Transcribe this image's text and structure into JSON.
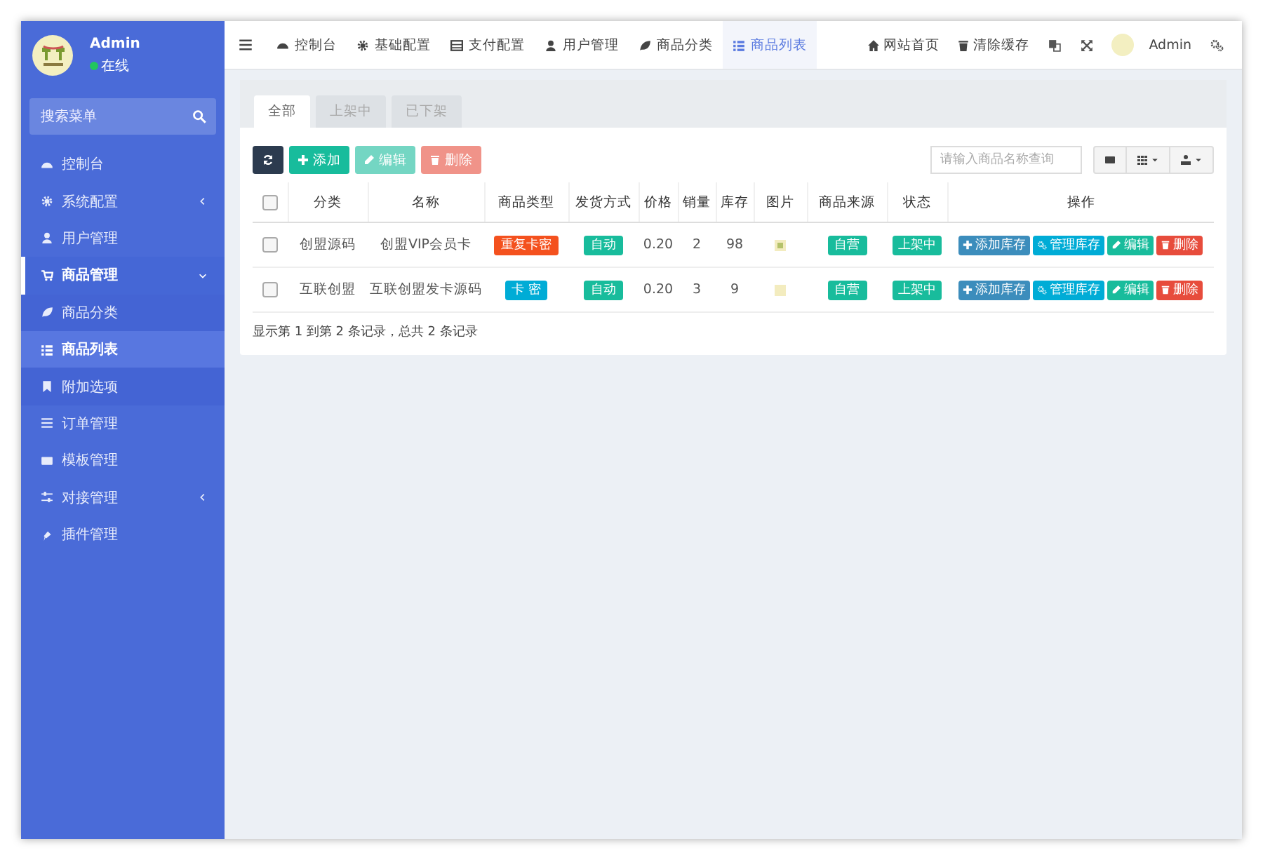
{
  "sidebar": {
    "user": {
      "name": "Admin",
      "status": "在线",
      "online": true
    },
    "search": {
      "placeholder": "搜索菜单"
    },
    "items": [
      {
        "label": "控制台",
        "selected": false
      },
      {
        "label": "系统配置",
        "selected": false,
        "expanded": false
      },
      {
        "label": "用户管理",
        "selected": false
      },
      {
        "label": "商品管理",
        "selected": false,
        "expanded": true,
        "children": [
          {
            "label": "商品分类",
            "selected": false
          },
          {
            "label": "商品列表",
            "selected": true
          },
          {
            "label": "附加选项",
            "selected": false
          }
        ]
      },
      {
        "label": "订单管理",
        "selected": false
      },
      {
        "label": "模板管理",
        "selected": false
      },
      {
        "label": "对接管理",
        "selected": false,
        "expanded": false
      },
      {
        "label": "插件管理",
        "selected": false
      }
    ]
  },
  "top_nav": {
    "tabs": [
      {
        "label": "控制台",
        "selected": false
      },
      {
        "label": "基础配置",
        "selected": false
      },
      {
        "label": "支付配置",
        "selected": false
      },
      {
        "label": "用户管理",
        "selected": false
      },
      {
        "label": "商品分类",
        "selected": false
      },
      {
        "label": "商品列表",
        "selected": true
      }
    ],
    "links": [
      "网站首页",
      "清除缓存"
    ],
    "user": "Admin"
  },
  "filter_tabs": [
    {
      "label": "全部",
      "selected": true
    },
    {
      "label": "上架中",
      "selected": false
    },
    {
      "label": "已下架",
      "selected": false
    }
  ],
  "toolbar": {
    "buttons": [
      {
        "kind": "refresh",
        "disabled": false
      },
      {
        "kind": "add",
        "label": "添加",
        "disabled": false
      },
      {
        "kind": "edit",
        "label": "编辑",
        "disabled": true
      },
      {
        "kind": "delete",
        "label": "删除",
        "disabled": true
      }
    ],
    "search": {
      "placeholder": "请输入商品名称查询"
    }
  },
  "table": {
    "header_checked": false,
    "columns": [
      "分类",
      "名称",
      "商品类型",
      "发货方式",
      "价格",
      "销量",
      "库存",
      "图片",
      "商品来源",
      "状态",
      "操作"
    ],
    "rows": [
      {
        "checked": false,
        "category": "创盟源码",
        "name": "创盟VIP会员卡",
        "type": {
          "text": "重复卡密",
          "color": "#f4511e"
        },
        "delivery": "自动",
        "price": "0.20",
        "sales": "2",
        "stock": "98",
        "source": "自营",
        "status": "上架中",
        "actions": [
          {
            "kind": "add",
            "label": "添加库存"
          },
          {
            "kind": "manage",
            "label": "管理库存"
          },
          {
            "kind": "edit",
            "label": "编辑"
          },
          {
            "kind": "delete",
            "label": "删除"
          }
        ]
      },
      {
        "checked": false,
        "category": "互联创盟",
        "name": "互联创盟发卡源码",
        "type": {
          "text": "卡 密",
          "color": "#00acd6"
        },
        "delivery": "自动",
        "price": "0.20",
        "sales": "3",
        "stock": "9",
        "source": "自营",
        "status": "上架中",
        "actions": [
          {
            "kind": "add",
            "label": "添加库存"
          },
          {
            "kind": "manage",
            "label": "管理库存"
          },
          {
            "kind": "edit",
            "label": "编辑"
          },
          {
            "kind": "delete",
            "label": "删除"
          }
        ]
      }
    ]
  },
  "pagination": {
    "summary": "显示第 1 到第 2 条记录，总共 2 条记录"
  }
}
